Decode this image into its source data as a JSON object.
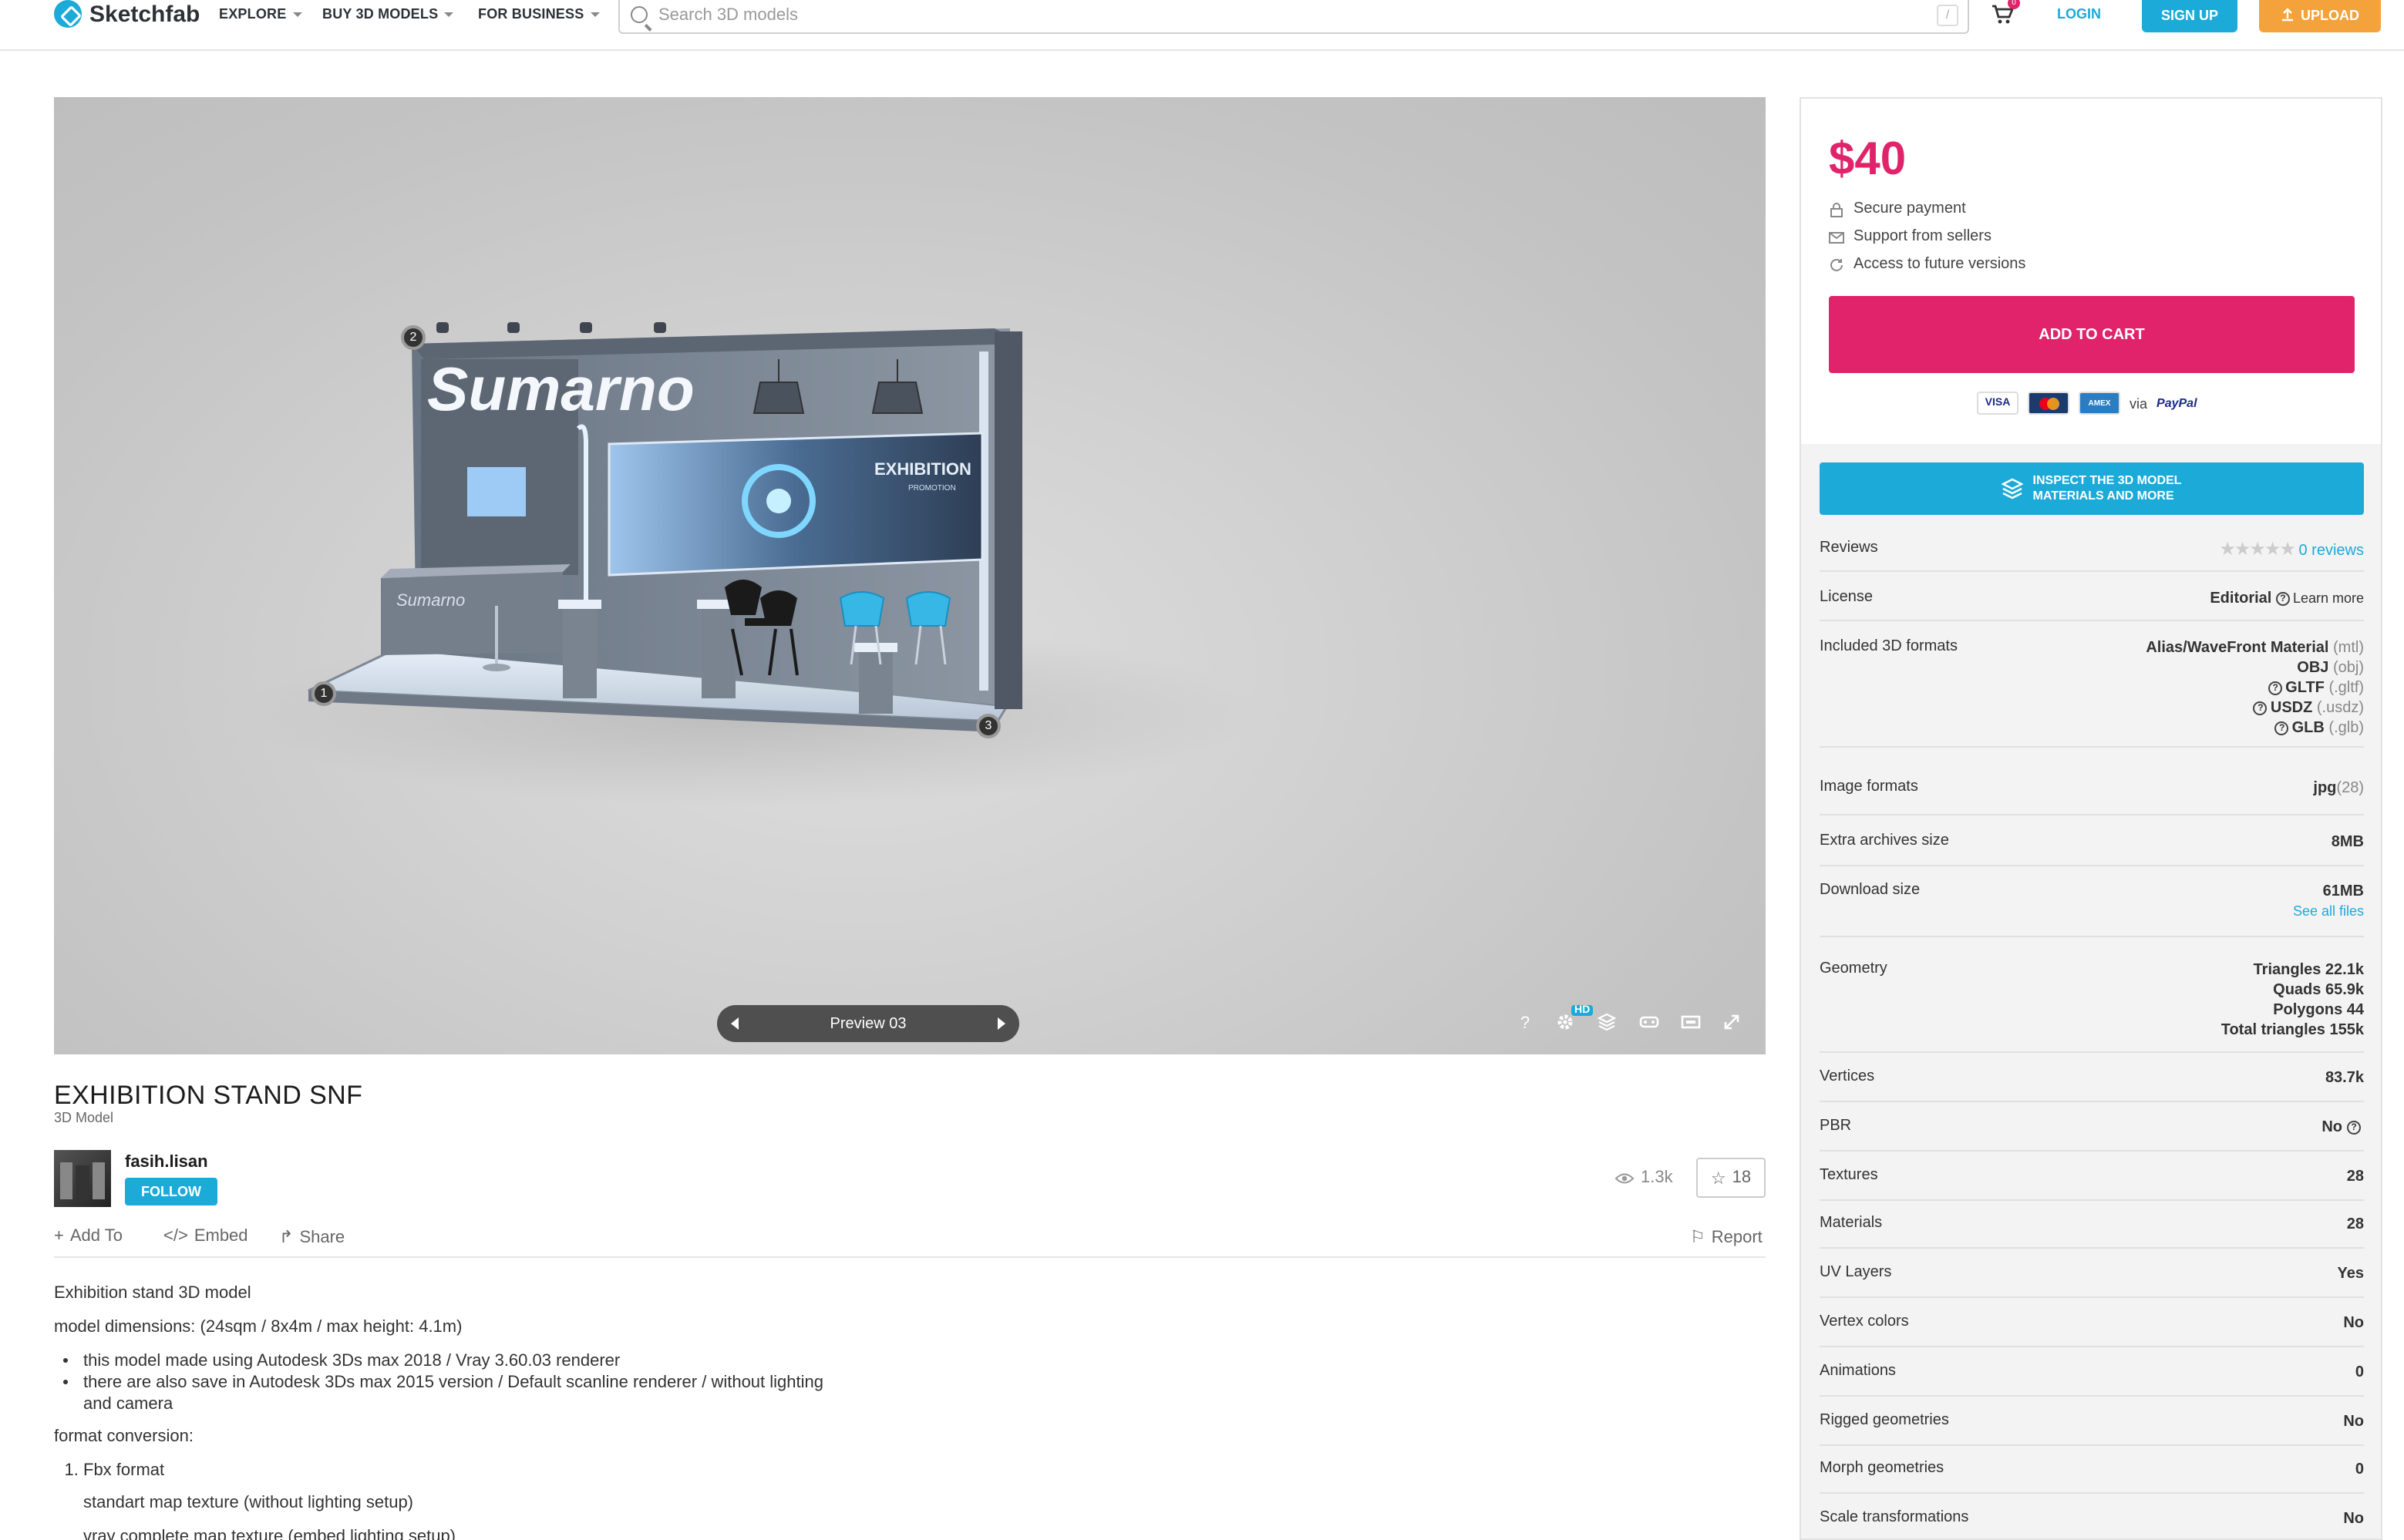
{
  "header": {
    "logo_text": "Sketchfab",
    "nav": [
      "EXPLORE",
      "BUY 3D MODELS",
      "FOR BUSINESS"
    ],
    "search_placeholder": "Search 3D models",
    "search_shortcut": "/",
    "cart_count": "0",
    "login": "LOGIN",
    "signup": "SIGN UP",
    "upload": "UPLOAD"
  },
  "viewer": {
    "scene_logo": "Sumarno",
    "scene_logo_small": "Sumarno",
    "scene_panel_text": "EXHIBITION",
    "scene_panel_sub": "PROMOTION",
    "preview_label": "Preview 03",
    "hotspots": [
      "1",
      "2",
      "3"
    ],
    "hd_badge": "HD",
    "help_glyph": "?"
  },
  "model": {
    "title": "EXHIBITION STAND SNF",
    "type": "3D Model",
    "author": "fasih.lisan",
    "follow": "FOLLOW",
    "views": "1.3k",
    "likes": "18"
  },
  "actions": {
    "add_to": "Add To",
    "embed": "Embed",
    "share": "Share",
    "report": "Report"
  },
  "description": {
    "p1": "Exhibition stand 3D model",
    "p2": "model dimensions: (24sqm / 8x4m / max height: 4.1m)",
    "bullets": [
      "this model made using Autodesk 3Ds max 2018 / Vray 3.60.03 renderer",
      "there are also save in Autodesk 3Ds max 2015 version / Default scanline renderer / without lighting and camera"
    ],
    "p3": "format conversion:",
    "ol1": "Fbx format",
    "ind1": "standart map texture (without lighting setup)",
    "ind2": "vray complete map texture (embed lighting setup)"
  },
  "buy": {
    "price": "$40",
    "features": [
      "Secure payment",
      "Support from sellers",
      "Access to future versions"
    ],
    "add_to_cart": "ADD TO CART",
    "cards": [
      "VISA",
      "MC",
      "AMEX"
    ],
    "via": "via",
    "paypal": "PayPal"
  },
  "specs": {
    "inspect_line1": "INSPECT THE 3D MODEL",
    "inspect_line2": "MATERIALS AND MORE",
    "reviews_label": "Reviews",
    "reviews_stars": "★★★★★",
    "reviews_value": "0 reviews",
    "license_label": "License",
    "license_value": "Editorial",
    "license_learn": "Learn more",
    "formats_label": "Included 3D formats",
    "formats": [
      {
        "name": "Alias/WaveFront Material",
        "ext": "(mtl)",
        "help": false
      },
      {
        "name": "OBJ",
        "ext": "(obj)",
        "help": false
      },
      {
        "name": "GLTF",
        "ext": "(.gltf)",
        "help": true
      },
      {
        "name": "USDZ",
        "ext": "(.usdz)",
        "help": true
      },
      {
        "name": "GLB",
        "ext": "(.glb)",
        "help": true
      }
    ],
    "image_formats_label": "Image formats",
    "image_formats_value": "jpg",
    "image_formats_count": "(28)",
    "extra_label": "Extra archives size",
    "extra_value": "8MB",
    "download_label": "Download size",
    "download_value": "61MB",
    "see_all": "See all files",
    "geometry_label": "Geometry",
    "geometry": [
      "Triangles 22.1k",
      "Quads 65.9k",
      "Polygons 44",
      "Total triangles 155k"
    ],
    "rows": [
      {
        "k": "Vertices",
        "v": "83.7k"
      },
      {
        "k": "PBR",
        "v": "No"
      },
      {
        "k": "Textures",
        "v": "28"
      },
      {
        "k": "Materials",
        "v": "28"
      },
      {
        "k": "UV Layers",
        "v": "Yes"
      },
      {
        "k": "Vertex colors",
        "v": "No"
      },
      {
        "k": "Animations",
        "v": "0"
      },
      {
        "k": "Rigged geometries",
        "v": "No"
      },
      {
        "k": "Morph geometries",
        "v": "0"
      },
      {
        "k": "Scale transformations",
        "v": "No"
      }
    ]
  },
  "colors": {
    "accent_blue": "#1caad9",
    "price_pink": "#e0236a",
    "upload_orange": "#f4a23c"
  }
}
